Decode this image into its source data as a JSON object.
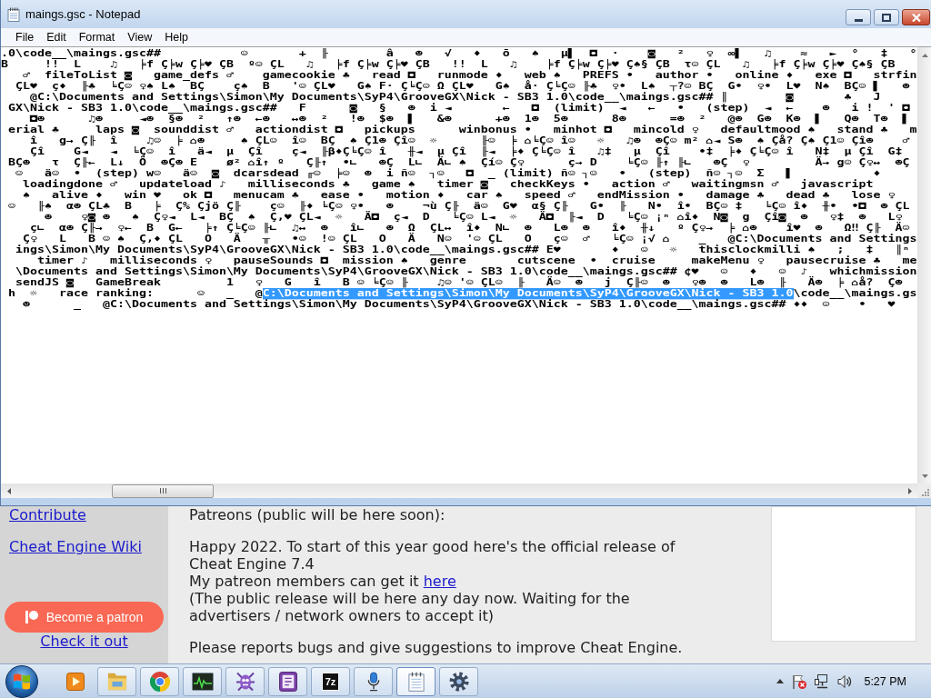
{
  "notepad": {
    "title": "maings.gsc - Notepad",
    "menu": [
      "File",
      "Edit",
      "Format",
      "View",
      "Help"
    ],
    "lines": [
      {
        "segments": [
          {
            "text": ".0\\code__\\maings.gsc##           ☺       +  ╟        â   ☻   √   ♦   ō   ♠   µ▌  ◘  ·    ◙   ²   ♀  ∞▌   ♫    ≈   ►  °   ‡   °",
            "selected": false
          }
        ]
      },
      {
        "segments": [
          {
            "text": "B     !!  L    ♫   ╞f Ç╞w Ç╞♥ ÇB  º☺ ÇL   ♫   ╞f Ç╞w Ç╞♥ ÇB   !!  L   ♫    ╞f Ç╞w Ç╞♥ Ç♠§ ÇB  τ☺ ÇL   ♫   ╞f Ç╞w Ç╞♥ Ç♠§ ÇB",
            "selected": false
          }
        ]
      },
      {
        "segments": [
          {
            "text": "   ♂  fileToList ◙   game_defs ♂    gamecookie ♣   read ◘   runmode ♦   web ♠   PREFS •   author •   online ♦   exe ◘   strfin",
            "selected": false
          }
        ]
      },
      {
        "segments": [
          {
            "text": "  ÇL♥  ç♦  ╟♣  ╘Ç☺ ♀♠ L♠  BÇ    ç♠  B   '☺ ÇL♥   G♠ F· Ç╘Ç☺ Ω ÇL♥   G♠  å· Ç╘Ç☺ ╟♣  ♀•  L♠  ┬?☺ BÇ  G•  ♀•  L♥  N♠  BÇ☺ ▌   ☻",
            "selected": false
          }
        ]
      },
      {
        "segments": [
          {
            "text": "    @C:\\Documents and Settings\\Simon\\My Documents\\SyP4\\GrooveGX\\Nick - SB3 1.0\\code__\\maings.gsc## ║        ◙       ♣   J",
            "selected": false
          }
        ]
      },
      {
        "segments": [
          {
            "text": " GX\\Nick - SB3 1.0\\code__\\maings.gsc##   F      ◙   §   ☻  i ◄       ←   ◘  (limit)  ◄   ←   •   (step)  ◄  ←    ☻   i !  ' ◘",
            "selected": false
          }
        ]
      },
      {
        "segments": [
          {
            "text": "    ◘☻      ♫☻     ◄☻  §☻  ²   ↑☻  ←☻   ↔☻  ²   !☻  $☻  ▌   &☻      +☻  1☻  5☻      8☻      =☻  ²   @☻  G☻  K☻  ▌   Q☻  T☻  ▌",
            "selected": false
          }
        ]
      },
      {
        "segments": [
          {
            "text": " erial ♣     laps ◙  sounddist ♂   actiondist ◘   pickups      winbonus •   minhot ◘   mincold ♀   defaultmood ♠   stand ♣   m",
            "selected": false
          }
        ]
      },
      {
        "segments": [
          {
            "text": "    î   g→ Ç╟  î    ♫☺  ╞ ⌂☻     ♠ ÇL☺  î☺  BÇ  ♠ Ç1☻ Çî☺  ☼      ╟☺  ╞ ⌂╘Ç☺ î☺   ☼   ♫☻  ☻Ç☺ m² ⌂◄ S☻  ♠ Çå? Ç♠ Ç1☺ Çî☻    ♂",
            "selected": false
          }
        ]
      },
      {
        "segments": [
          {
            "text": "    Çî    G◄   ◄  ╘Ç☺  î   ä◄  µ  Çî    ç◄  ╟β♦Ç╘Ç☺ î   ╫◄  µ Çî  ╟◄  ╞♦ Ç╘Ç☺ î   ♫‡   µ  Çî    •‡  ╞♦ Ç╘Ç☺ î   N‡  µ Çî  G‡",
            "selected": false
          }
        ]
      },
      {
        "segments": [
          {
            "text": " BÇ☻   τ  Ç╟←  L↓  Ö  ☻Ç☻ E    ø² ⌂î↑ º   Ç╟↑  •∟   ☻Ç  L∟  Ä∟ ♠  Çí☺ Ç♀      ç→ D    ╘Ç☺ ╟↑ ╟∟   ☻Ç  ♀         Ä→ g☺ Ç♀↔  ☻Ç",
            "selected": false
          }
        ]
      },
      {
        "segments": [
          {
            "text": "  ☺   ä☺  •  (step) w☺   ä☺  ◙  dcarsdead ╓☺  ╞☺  ☻  i ñ☺  ┐☺   ◘  _ (limit) ñ☺ ┐☺   •   (step)  ñ☺ ┐☺  Σ   ▌           ♦",
            "selected": false
          }
        ]
      },
      {
        "segments": [
          {
            "text": "   loadingdone ♂   updateload ♪   milliseconds ♣   game ♠   timer ◙   checkKeys •   action ♂   waitingmsn ♂   javascript",
            "selected": false
          }
        ]
      },
      {
        "segments": [
          {
            "text": "   ♠   alive ♦   win ♥   ok ◘   menucam ♣   ease •   motion ♦   car ♠   speed ♂   endMission •   damage ♣   dead ♣   lose ♀",
            "selected": false
          }
        ]
      },
      {
        "segments": [
          {
            "text": " ☺   ╟♠  α☻ ÇL♣  B   ╞  Ç% Çjö Ç╟    ç☺  ╟♦ ╘Ç☺ ♀•   ☻    ¬ù Ç╟  ä☺  G♥  α§ Ç╟   G•  ╟   N•  î•  BÇ☺ ‡   ╘Ç☺ î♦  ╫•  •◘  ☻ ÇL",
            "selected": false
          }
        ]
      },
      {
        "segments": [
          {
            "text": "      ☻    ♀◙ ☻   ♠  Ç♀◄  L◄  BÇ  ♠  Ç,♥ ÇL◄  ☼   Ä◘  ç◄  D   ╘Ç☺ L◄  ☼   Ä◘  ╟◄  D   ╘Ç☺ ¡ⁿ ⌂î♦  N◙  g  Çî◙  ☻   ♀‡  ☻   L♀",
            "selected": false
          }
        ]
      },
      {
        "segments": [
          {
            "text": "    ç∟  α☻ Ç╟→  ♀←  B  G←   ╞↑ Ç╘Ç☺ ╟∟  ♫↔  ☻   î∟   ☻  Ω  ÇL↔  î♦  N∟  ☻   L☻  ☻   î♦  ╫↓   º Ç♀→  ╞ ⌂☻    î♥  ☻   Ω‼ Ç╟  Ä☺",
            "selected": false
          }
        ]
      },
      {
        "segments": [
          {
            "text": "   Ç♀   L   B ☺ ♠  Ç,♦ ÇL   O   Ä   ╥   •☺  !☺ ÇL   O   Ä   N☺  '☺ ÇL   O   ç☺  ♂   ╘Ç☺ ¡√ ⌂    _   @C:\\Documents and Settings",
            "selected": false
          }
        ]
      },
      {
        "segments": [
          {
            "text": "  ings\\Simon\\My Documents\\SyP4\\GrooveGX\\Nick - SB3 1.0\\code__\\maings.gsc## E♥       ♦   ☺   ☼   thisclockmilli ♠   ;   ‡   ║ⁿ",
            "selected": false
          }
        ]
      },
      {
        "segments": [
          {
            "text": "     timer ♪   milliseconds ♀   pauseSounds ◘  mission ♠   genre       cutscene  •  cruise     makeMenu ♀   pausecruise ♣   me",
            "selected": false
          }
        ]
      },
      {
        "segments": [
          {
            "text": "  \\Documents and Settings\\Simon\\My Documents\\SyP4\\GrooveGX\\Nick - SB3 1.0\\code__\\maings.gsc## ¢♥   ☺   ♦   ☺  ♪   whichmission",
            "selected": false
          }
        ]
      },
      {
        "segments": [
          {
            "text": "  sendJS ◙   GameBreak         1   ♀   G   î   B ☺ ╘Ç☺ ╟    ♫☺ '☺ ÇL☺  ╟   Ä☺  ☻   j  Ç╟☺  ☻   ♀☻  ☻   L☻  ╟   Ä☻  ╞ ⌂å?  Ç☻",
            "selected": false
          }
        ]
      },
      {
        "segments": [
          {
            "text": " h  ☼   race ranking:      ☺   _   @",
            "selected": false
          },
          {
            "text": "C:\\Documents and Settings\\Simon\\My Documents\\SyP4\\GrooveGX\\Nick - SB3 1.0",
            "selected": true
          },
          {
            "text": "\\code__\\maings.gs",
            "selected": false
          }
        ]
      },
      {
        "segments": [
          {
            "text": "   ☻      _   @C:\\Documents and Settings\\Simon\\My Documents\\SyP4\\GrooveGX\\Nick - SB3 1.0\\code__\\maings.gsc## ♦♦  ☺    •   ♥",
            "selected": false
          }
        ]
      }
    ]
  },
  "webpage": {
    "sidebar": {
      "links": [
        "Contribute",
        "Cheat Engine Wiki"
      ],
      "patron_button": "Become a patron",
      "patron_link": "Check it out"
    },
    "content": {
      "paragraphs": [
        {
          "lines": [
            {
              "text": "Patreons (public will be here soon):"
            }
          ]
        },
        {
          "lines": [
            {
              "text": "Happy 2022. To start of this year good here's the official release of Cheat Engine 7.4"
            },
            {
              "text": "My patreon members can get it ",
              "link": "here"
            },
            {
              "text": "(The public release will be here any day now. Waiting for the advertisers / network owners to accept it)"
            }
          ]
        },
        {
          "lines": [
            {
              "text": "Please reports bugs and give suggestions to improve Cheat Engine."
            }
          ]
        }
      ]
    }
  },
  "taskbar": {
    "quick_launch": [
      {
        "kind": "player"
      }
    ],
    "apps": [
      {
        "kind": "folder",
        "selected": false
      },
      {
        "kind": "browser",
        "selected": false
      },
      {
        "kind": "monitor",
        "selected": false
      },
      {
        "kind": "creature",
        "selected": false
      },
      {
        "kind": "document",
        "selected": false
      },
      {
        "kind": "archive",
        "label": "7z",
        "selected": false
      },
      {
        "kind": "microphone",
        "selected": false
      },
      {
        "kind": "notepad",
        "selected": true
      },
      {
        "kind": "gear",
        "selected": false
      }
    ],
    "clock": "5:27 PM"
  }
}
